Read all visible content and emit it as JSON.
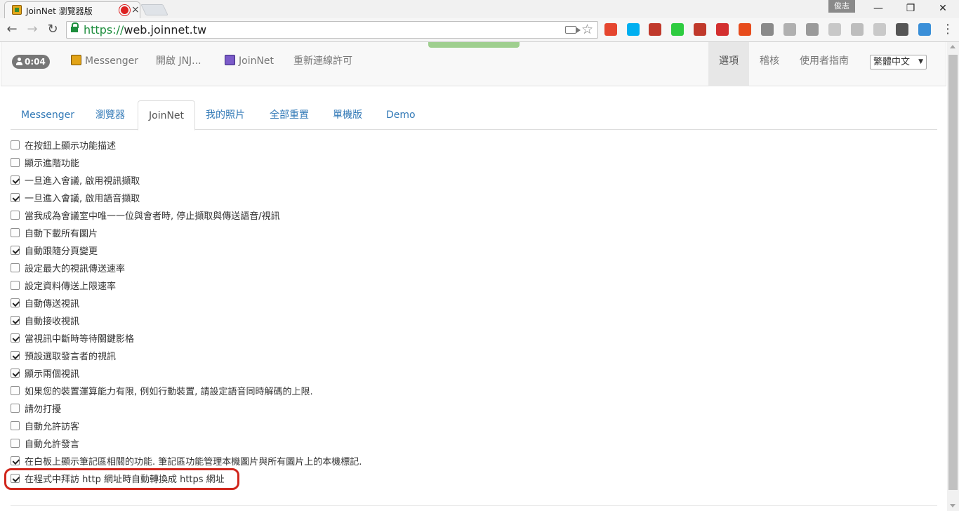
{
  "browser": {
    "tab_title": "JoinNet 瀏覽器版",
    "tab_close": "×",
    "user_name": "俊志",
    "window": {
      "minimize": "—",
      "maximize": "❐",
      "close": "✕"
    },
    "nav": {
      "back": "←",
      "forward": "→",
      "reload": "↻"
    },
    "url_scheme": "https://",
    "url_host": "web.joinnet.tw",
    "star": "☆",
    "menu": "⋮",
    "extensions": [
      {
        "name": "multicolor-extension-icon",
        "color": "#e5462f"
      },
      {
        "name": "skype-icon",
        "color": "#00aff0"
      },
      {
        "name": "red-book-icon",
        "color": "#c0392b"
      },
      {
        "name": "green-leaf-icon",
        "color": "#2ecc40"
      },
      {
        "name": "lite-extension-icon",
        "color": "#c0392b"
      },
      {
        "name": "avira-icon",
        "color": "#d32f2f"
      },
      {
        "name": "office-icon",
        "color": "#e74c1c"
      },
      {
        "name": "gray-box-icon",
        "color": "#8a8a8a"
      },
      {
        "name": "m-extension-icon",
        "color": "#b0b0b0"
      },
      {
        "name": "s-extension-icon",
        "color": "#9a9a9a"
      },
      {
        "name": "gray-doc-icon",
        "color": "#c8c8c8"
      },
      {
        "name": "drive-icon",
        "color": "#bdbdbd"
      },
      {
        "name": "exif-icon",
        "color": "#c9c9c9"
      },
      {
        "name": "tampermonkey-icon",
        "color": "#555555"
      },
      {
        "name": "cloud-icon",
        "color": "#3a8fd8"
      }
    ]
  },
  "topnav": {
    "timer": "0:04",
    "items": [
      "Messenger",
      "開啟 JNJ...",
      "JoinNet",
      "重新連線許可"
    ],
    "right_items": [
      "選項",
      "稽核",
      "使用者指南"
    ],
    "language": "繁體中文",
    "language_arrow": "▼"
  },
  "tabs": [
    "Messenger",
    "瀏覽器",
    "JoinNet",
    "我的照片",
    "全部重置",
    "單機版",
    "Demo"
  ],
  "active_tab": "JoinNet",
  "options": [
    {
      "label": "在按鈕上顯示功能描述",
      "checked": false
    },
    {
      "label": "顯示進階功能",
      "checked": false
    },
    {
      "label": "一旦進入會議, 啟用視訊擷取",
      "checked": true
    },
    {
      "label": "一旦進入會議, 啟用語音擷取",
      "checked": true
    },
    {
      "label": "當我成為會議室中唯一一位與會者時, 停止擷取與傳送語音/視訊",
      "checked": false
    },
    {
      "label": "自動下載所有圖片",
      "checked": false
    },
    {
      "label": "自動跟隨分頁變更",
      "checked": true
    },
    {
      "label": "設定最大的視訊傳送速率",
      "checked": false
    },
    {
      "label": "設定資料傳送上限速率",
      "checked": false
    },
    {
      "label": "自動傳送視訊",
      "checked": true
    },
    {
      "label": "自動接收視訊",
      "checked": true
    },
    {
      "label": "當視訊中斷時等待關鍵影格",
      "checked": true
    },
    {
      "label": "預設選取發言者的視訊",
      "checked": true
    },
    {
      "label": "顯示兩個視訊",
      "checked": true
    },
    {
      "label": "如果您的裝置運算能力有限, 例如行動裝置, 請設定語音同時解碼的上限.",
      "checked": false
    },
    {
      "label": "請勿打擾",
      "checked": false
    },
    {
      "label": "自動允許訪客",
      "checked": false
    },
    {
      "label": "自動允許發言",
      "checked": false
    },
    {
      "label": "在白板上顯示筆記區相關的功能. 筆記區功能管理本機圖片與所有圖片上的本機標記.",
      "checked": true
    },
    {
      "label": "在程式中拜訪 http 網址時自動轉換成 https 網址",
      "checked": true
    }
  ]
}
